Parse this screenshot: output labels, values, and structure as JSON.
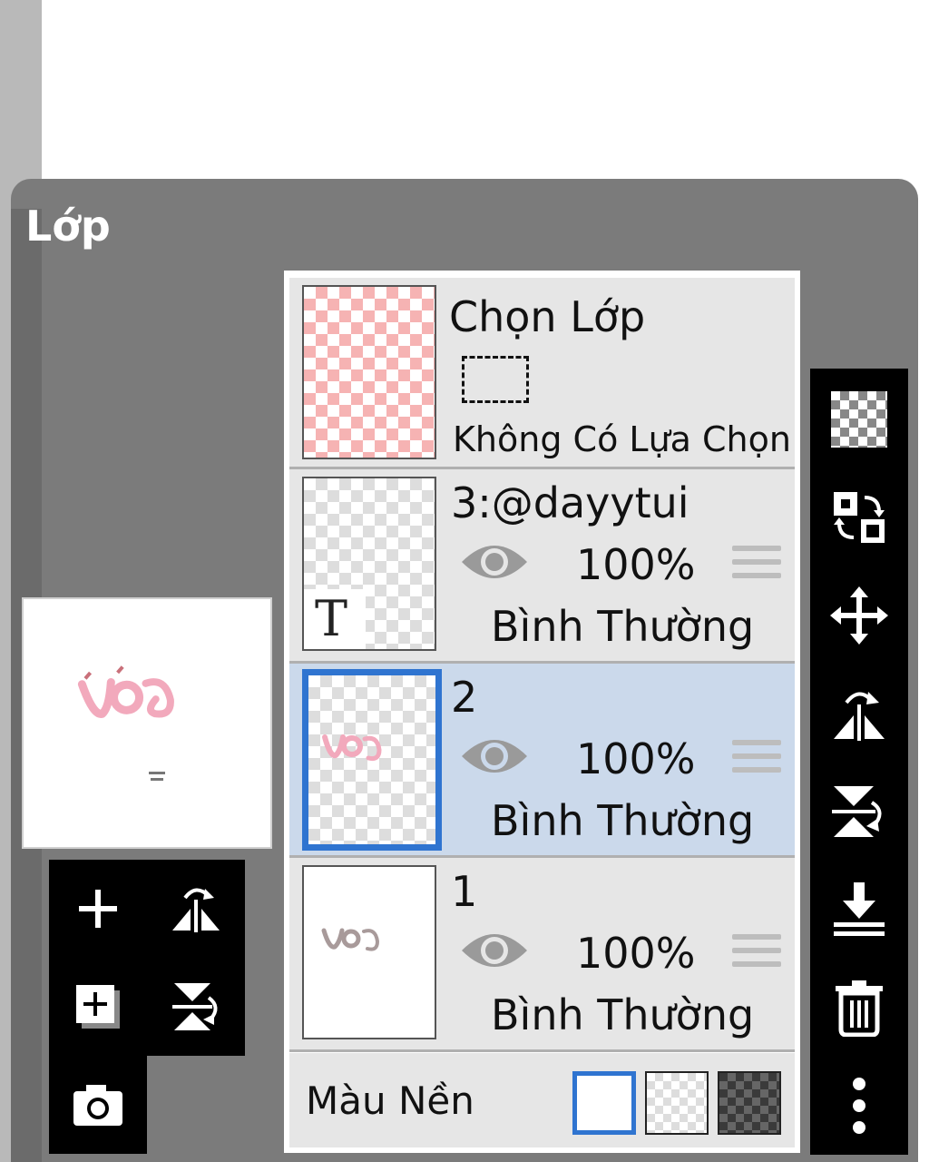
{
  "panel": {
    "title": "Lớp"
  },
  "selection_row": {
    "title": "Chọn Lớp",
    "status": "Không Có Lựa Chọn"
  },
  "layers": [
    {
      "name": "3:@dayytui",
      "opacity": "100%",
      "blend_mode": "Bình Thường",
      "thumb_glyph": "T",
      "visible": true,
      "active": false
    },
    {
      "name": "2",
      "opacity": "100%",
      "blend_mode": "Bình Thường",
      "visible": true,
      "active": true
    },
    {
      "name": "1",
      "opacity": "100%",
      "blend_mode": "Bình Thường",
      "visible": true,
      "active": false
    }
  ],
  "background": {
    "label": "Màu Nền",
    "options": [
      "white",
      "transparent",
      "dark-checker"
    ],
    "selected": "white"
  },
  "colors": {
    "accent": "#2f74d0",
    "active_row": "#cbd9eb",
    "panel": "#7b7b7b",
    "toolbar": "#000000"
  },
  "left_toolbar": [
    "add-layer-icon",
    "flip-horizontal-icon",
    "add-copy-layer-icon",
    "flip-vertical-icon",
    "camera-icon"
  ],
  "right_toolbar": [
    "transparency-icon",
    "swap-layers-icon",
    "move-icon",
    "flip-horizontal-icon",
    "flip-vertical-icon",
    "merge-down-icon",
    "delete-icon",
    "more-icon"
  ]
}
